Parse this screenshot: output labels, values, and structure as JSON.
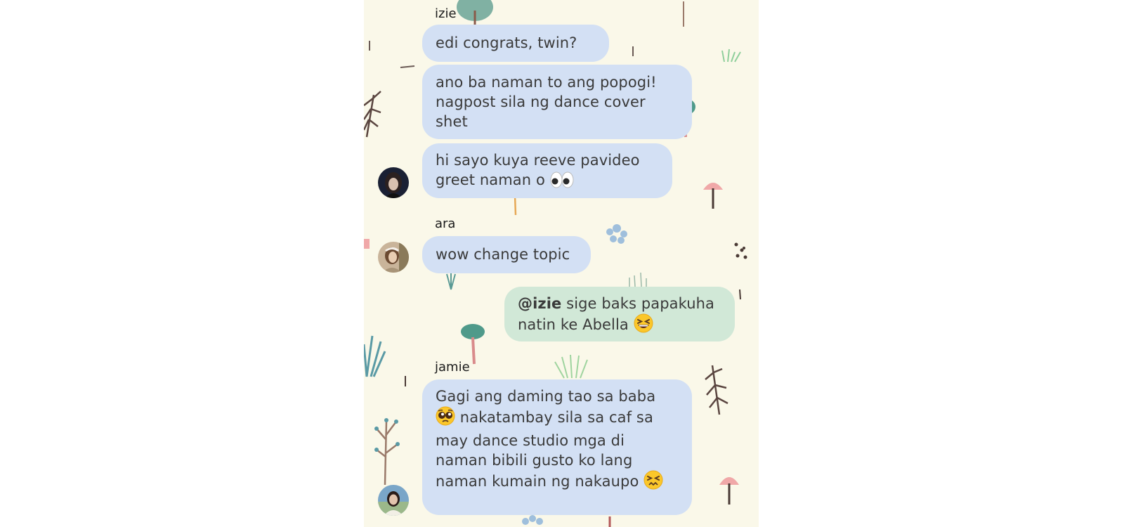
{
  "conversation": {
    "messages": [
      {
        "sender": "izie",
        "text": "edi congrats, twin?"
      },
      {
        "text": "ano ba naman to ang popogi! nagpost sila ng dance cover shet"
      },
      {
        "text": "hi sayo kuya reeve pavideo greet naman o",
        "emoji": "eyes-emoji"
      },
      {
        "sender": "ara",
        "text": "wow change topic"
      },
      {
        "mention": "@izie",
        "text": " sige baks papakuha natin ke Abella",
        "emoji": "grinning-squinting-face-emoji",
        "outgoing": true
      },
      {
        "sender": "jamie",
        "text_a": "Gagi ang daming tao sa baba",
        "text_b": "nakatambay sila sa caf sa may dance studio mga di naman bibili gusto ko lang naman kumain ng nakaupo",
        "emoji_a": "pleading-face-emoji",
        "emoji_b": "confounded-face-emoji"
      }
    ]
  },
  "colors": {
    "background": "#faf8e9",
    "incoming_bubble": "#d3e0f4",
    "outgoing_bubble": "#d1e8d7",
    "text": "#3a3a3a"
  }
}
